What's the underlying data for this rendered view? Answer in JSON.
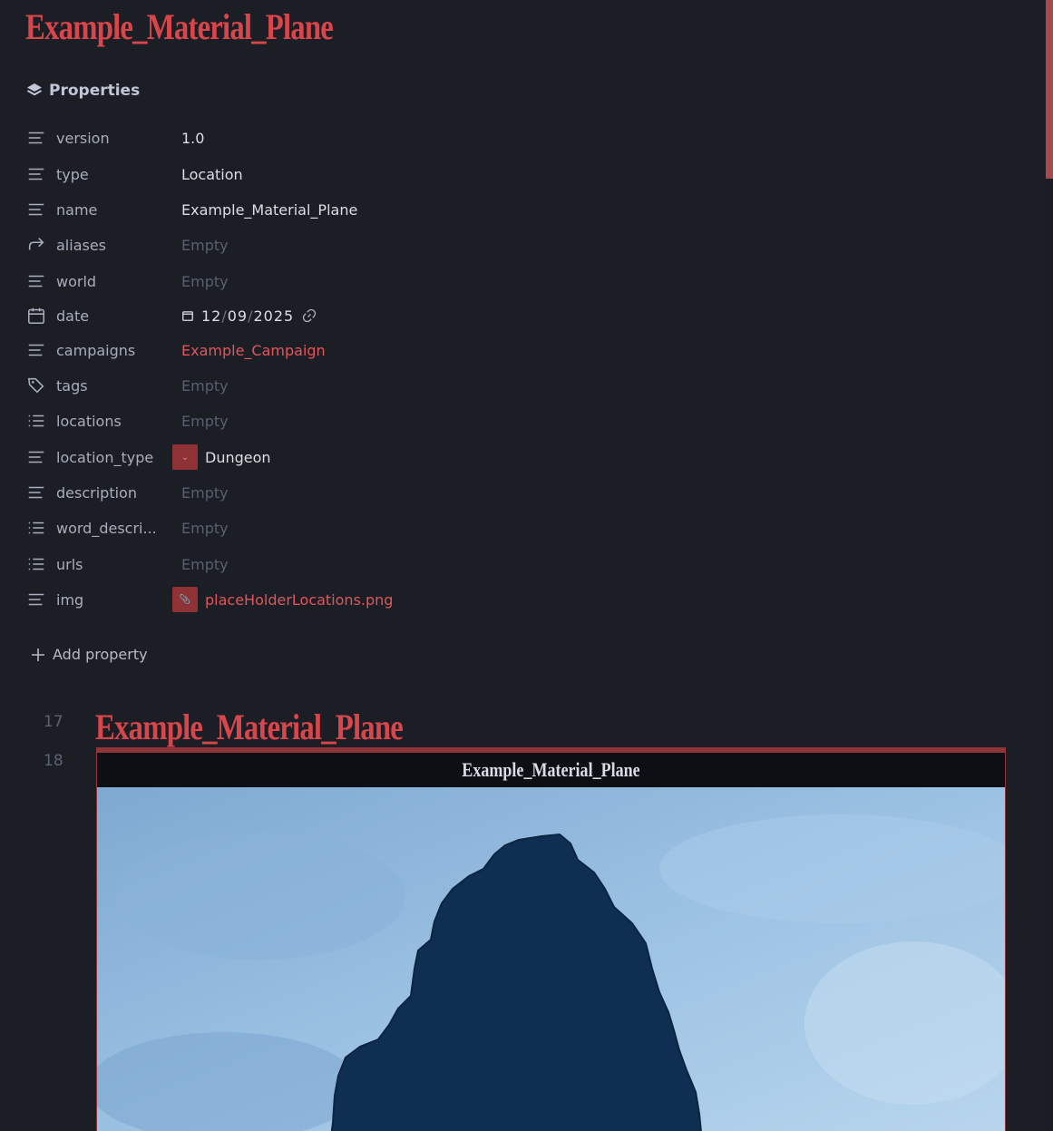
{
  "note_title": "Example_Material_Plane",
  "properties_header": "Properties",
  "properties": [
    {
      "key": "version",
      "value": "1.0",
      "icon": "text-lines-icon",
      "style": "normal"
    },
    {
      "key": "type",
      "value": "Location",
      "icon": "text-lines-icon",
      "style": "normal"
    },
    {
      "key": "name",
      "value": "Example_Material_Plane",
      "icon": "text-lines-icon",
      "style": "normal"
    },
    {
      "key": "aliases",
      "value": "Empty",
      "icon": "forward-arrow-icon",
      "style": "empty"
    },
    {
      "key": "world",
      "value": "Empty",
      "icon": "text-lines-icon",
      "style": "empty"
    },
    {
      "key": "date",
      "value": "",
      "icon": "calendar-icon",
      "style": "date"
    },
    {
      "key": "campaigns",
      "value": "Example_Campaign",
      "icon": "text-lines-icon",
      "style": "link"
    },
    {
      "key": "tags",
      "value": "Empty",
      "icon": "tags-icon",
      "style": "empty"
    },
    {
      "key": "locations",
      "value": "Empty",
      "icon": "list-icon",
      "style": "empty"
    },
    {
      "key": "location_type",
      "value": "Dungeon",
      "icon": "text-lines-icon",
      "style": "select"
    },
    {
      "key": "description",
      "value": "Empty",
      "icon": "text-lines-icon",
      "style": "empty"
    },
    {
      "key": "word_descri...",
      "value": "Empty",
      "icon": "list-icon",
      "style": "empty"
    },
    {
      "key": "urls",
      "value": "Empty",
      "icon": "list-icon",
      "style": "empty"
    },
    {
      "key": "img",
      "value": "placeHolderLocations.png",
      "icon": "text-lines-icon",
      "style": "file"
    }
  ],
  "date": {
    "month": "12",
    "day": "09",
    "year": "2025",
    "sep": "/"
  },
  "add_property_label": "Add property",
  "line_numbers": [
    "17",
    "18"
  ],
  "heading": "Example_Material_Plane",
  "infobox_title": "Example_Material_Plane",
  "colors": {
    "accent": "#d7464a",
    "background": "#1c1e26",
    "map_light": "#8fb8dc",
    "map_dark": "#123558"
  }
}
